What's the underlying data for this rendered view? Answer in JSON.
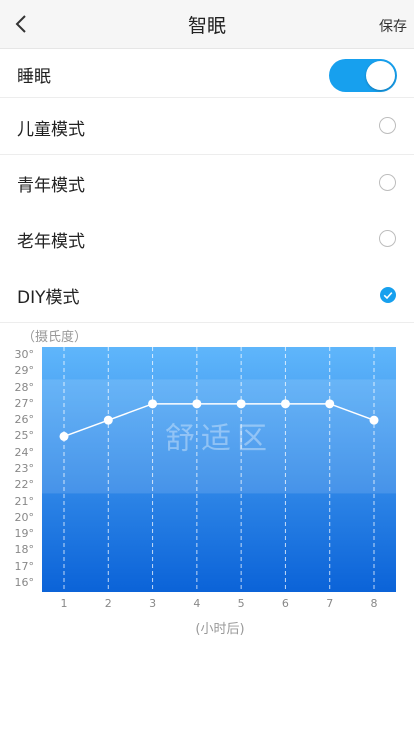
{
  "header": {
    "title": "智眠",
    "save_label": "保存",
    "back_icon": "chevron-left-icon"
  },
  "sleep_row": {
    "label": "睡眠",
    "toggle_on": true,
    "accent": "#17a0ee"
  },
  "modes": [
    {
      "label": "儿童模式",
      "selected": false
    },
    {
      "label": "青年模式",
      "selected": false
    },
    {
      "label": "老年模式",
      "selected": false
    },
    {
      "label": "DIY模式",
      "selected": true
    }
  ],
  "chart_data": {
    "type": "line",
    "unit_label": "（摄氏度）",
    "xlabel": "(小时后)",
    "x": [
      1,
      2,
      3,
      4,
      5,
      6,
      7,
      8
    ],
    "values": [
      25,
      26,
      27,
      27,
      27,
      27,
      27,
      26
    ],
    "ylim": [
      16,
      30
    ],
    "yticks": [
      "30°",
      "29°",
      "28°",
      "27°",
      "26°",
      "25°",
      "24°",
      "23°",
      "22°",
      "21°",
      "20°",
      "19°",
      "18°",
      "17°",
      "16°"
    ],
    "comfort_zone": {
      "label": "舒适区",
      "range": [
        22,
        28
      ]
    },
    "colors": {
      "top": "#5fb6fb",
      "bottom": "#0b63d8",
      "line": "#ffffff"
    }
  }
}
